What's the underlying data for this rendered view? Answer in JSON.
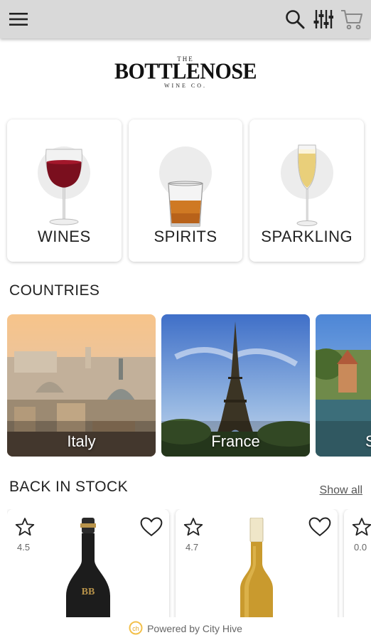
{
  "header": {
    "menu_icon": "hamburger-menu-icon",
    "search_icon": "search-icon",
    "filter_icon": "sliders-filter-icon",
    "cart_icon": "shopping-cart-icon"
  },
  "logo": {
    "the": "THE",
    "brand": "BOTTLENOSE",
    "sub": "WINE CO."
  },
  "categories": [
    {
      "label": "WINES",
      "icon": "red-wine-glass"
    },
    {
      "label": "SPIRITS",
      "icon": "whiskey-tumbler"
    },
    {
      "label": "SPARKLING",
      "icon": "champagne-flute"
    }
  ],
  "countries_section": {
    "title": "COUNTRIES",
    "items": [
      {
        "name": "Italy"
      },
      {
        "name": "France"
      },
      {
        "name": "S"
      }
    ]
  },
  "stock_section": {
    "title": "BACK IN STOCK",
    "show_all": "Show all",
    "products": [
      {
        "rating": "4.5"
      },
      {
        "rating": "4.7"
      },
      {
        "rating": "0.0"
      }
    ]
  },
  "footer": {
    "text": "Powered by City Hive",
    "logo_icon": "city-hive-logo-icon"
  },
  "colors": {
    "header_bg": "#d9d9d9",
    "wine_red": "#7a0f1e",
    "accent_yellow": "#f3c04a"
  }
}
